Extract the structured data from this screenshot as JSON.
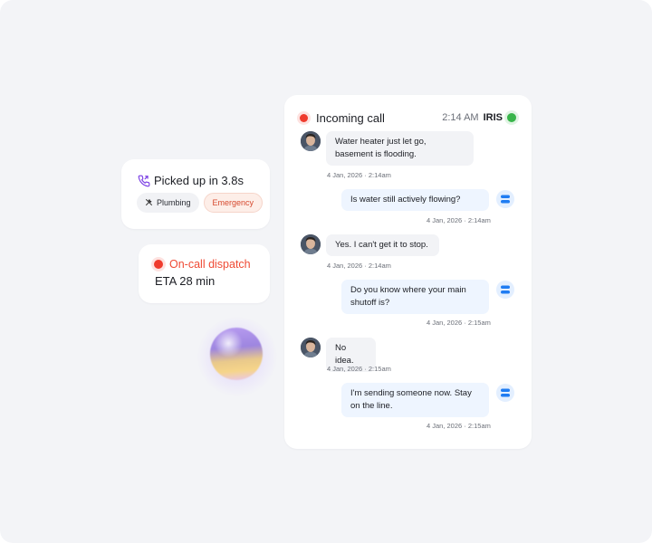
{
  "pickup_card": {
    "title": "Picked up in 3.8s",
    "tags": [
      "Plumbing",
      "Emergency"
    ]
  },
  "dispatch_card": {
    "label": "On-call dispatch",
    "eta": "ETA 28 min"
  },
  "chat": {
    "title": "Incoming call",
    "time": "2:14 AM",
    "agent": "IRIS",
    "messages": [
      {
        "from": "caller",
        "text": "Water heater just let go, basement is flooding.",
        "stamp": "4 Jan, 2026 · 2:14am"
      },
      {
        "from": "agent",
        "text": "Is water still actively flowing?",
        "stamp": "4 Jan, 2026 · 2:14am"
      },
      {
        "from": "caller",
        "text": "Yes. I can't get it to stop.",
        "stamp": "4 Jan, 2026 · 2:14am"
      },
      {
        "from": "agent",
        "text": "Do you know where your main shutoff is?",
        "stamp": "4 Jan, 2026 · 2:15am"
      },
      {
        "from": "caller",
        "text": "No idea.",
        "stamp": "4 Jan, 2026 · 2:15am"
      },
      {
        "from": "agent",
        "text": "I'm sending someone now. Stay on the line.",
        "stamp": "4 Jan, 2026 · 2:15am"
      }
    ]
  },
  "colors": {
    "accent_red": "#ef3b2d",
    "status_green": "#38b54a",
    "phone_purple": "#7b3fe4",
    "bot_blue": "#1f7cf2"
  },
  "icons": {
    "pickup": "phone-icon",
    "plumbing": "wrench-icon",
    "agent": "bot-icon"
  }
}
